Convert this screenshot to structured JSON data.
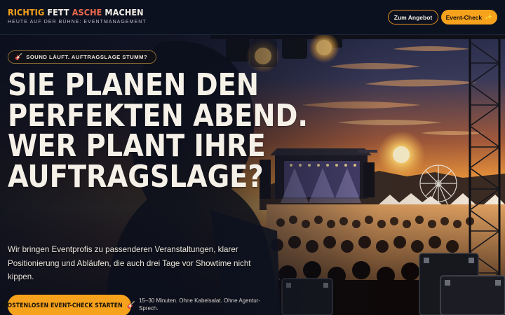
{
  "brand": {
    "title_words": [
      "RICHTIG",
      "FETT",
      "ASCHE",
      "MACHEN"
    ],
    "subtitle": "HEUTE AUF DER BÜHNE: EVENTMANAGEMENT"
  },
  "nav": {
    "offer_label": "Zum Angebot",
    "check_label": "Event-Check",
    "check_icon": "sparkle-icon"
  },
  "hero": {
    "badge": "SOUND LÄUFT. AUFTRAGSLAGE STUMM?",
    "badge_icon": "guitar-icon",
    "headline": [
      "SIE PLANEN DEN",
      "PERFEKTEN ABEND.",
      "WER PLANT IHRE",
      "AUFTRAGSLAGE?"
    ],
    "lead": "Wir bringen Eventprofis zu passenderen Veranstaltungen, klarer Positionierung und Abläufen, die auch drei Tage vor Showtime nicht kippen.",
    "cta_label": "KOSTENLOSEN EVENT-CHECK STARTEN",
    "cta_icon": "guitar-icon",
    "cta_note": "15–30 Minuten. Ohne Kabelsalat. Ohne Agentur-Sprech."
  },
  "colors": {
    "accent": "#f7a21c",
    "accent_red": "#ee6a4c",
    "header_bg": "#0c1120",
    "text": "#f4efe6"
  }
}
